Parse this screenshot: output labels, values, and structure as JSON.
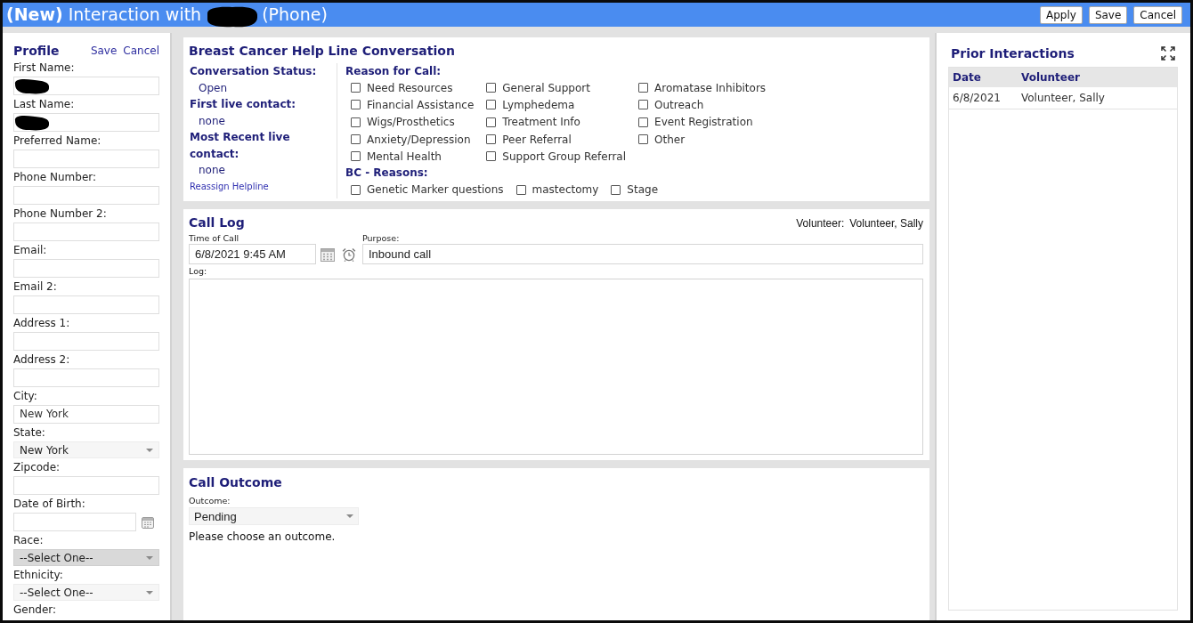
{
  "header": {
    "badge": "(New)",
    "title": "Interaction with",
    "contact_redacted": true,
    "channel": "(Phone)",
    "buttons": [
      "Apply",
      "Save",
      "Cancel"
    ]
  },
  "profile": {
    "title": "Profile",
    "actions": [
      "Save",
      "Cancel"
    ],
    "fields": [
      {
        "label": "First Name:",
        "kind": "text",
        "redacted": true
      },
      {
        "label": "Last Name:",
        "kind": "text",
        "redacted": true
      },
      {
        "label": "Preferred Name:",
        "kind": "text",
        "redacted": false
      },
      {
        "label": "Phone Number:",
        "kind": "text",
        "redacted": false
      },
      {
        "label": "Phone Number 2:",
        "kind": "text",
        "redacted": false
      },
      {
        "label": "Email:",
        "kind": "text",
        "redacted": false
      },
      {
        "label": "Email 2:",
        "kind": "text",
        "redacted": false
      },
      {
        "label": "Address 1:",
        "kind": "text",
        "redacted": false
      },
      {
        "label": "Address 2:",
        "kind": "text",
        "redacted": false
      },
      {
        "label": "City:",
        "kind": "text",
        "value": "New York",
        "redacted": false
      },
      {
        "label": "State:",
        "kind": "select",
        "value": "New York",
        "highlighted": false
      },
      {
        "label": "Zipcode:",
        "kind": "text",
        "redacted": false
      },
      {
        "label": "Date of Birth:",
        "kind": "date",
        "redacted": false
      },
      {
        "label": "Race:",
        "kind": "select",
        "value": "--Select One--",
        "highlighted": true
      },
      {
        "label": "Ethnicity:",
        "kind": "select",
        "value": "--Select One--",
        "highlighted": false
      },
      {
        "label": "Gender:",
        "kind": "label"
      }
    ]
  },
  "conversation": {
    "title": "Breast Cancer Help Line Conversation",
    "status": [
      {
        "label": "Conversation Status:",
        "value": "Open"
      },
      {
        "label": "First live contact:",
        "value": "none"
      },
      {
        "label": "Most Recent live contact:",
        "value": "none"
      }
    ],
    "link": "Reassign Helpline",
    "reason_groups": [
      {
        "title": "Reason for Call:",
        "kind": "grid",
        "options": [
          {
            "label": "Need Resources",
            "checked": false
          },
          {
            "label": "General Support",
            "checked": false
          },
          {
            "label": "Aromatase Inhibitors",
            "checked": false
          },
          {
            "label": "Financial Assistance",
            "checked": false
          },
          {
            "label": "Lymphedema",
            "checked": false
          },
          {
            "label": "Outreach",
            "checked": false
          },
          {
            "label": "Wigs/Prosthetics",
            "checked": false
          },
          {
            "label": "Treatment Info",
            "checked": false
          },
          {
            "label": "Event Registration",
            "checked": false
          },
          {
            "label": "Anxiety/Depression",
            "checked": false
          },
          {
            "label": "Peer Referral",
            "checked": false
          },
          {
            "label": "Other",
            "checked": false
          },
          {
            "label": "Mental Health",
            "checked": false
          },
          {
            "label": "Support Group Referral",
            "checked": false
          }
        ]
      },
      {
        "title": "BC - Reasons:",
        "kind": "row",
        "options": [
          {
            "label": "Genetic Marker questions",
            "checked": false
          },
          {
            "label": "mastectomy",
            "checked": false
          },
          {
            "label": "Stage",
            "checked": false
          }
        ]
      }
    ]
  },
  "call_log": {
    "title": "Call Log",
    "volunteer_label": "Volunteer:",
    "volunteer": "Volunteer, Sally",
    "time_label": "Time of Call",
    "time": "6/8/2021 9:45 AM",
    "purpose_label": "Purpose:",
    "purpose": "Inbound call",
    "log_label": "Log:"
  },
  "call_outcome": {
    "title": "Call Outcome",
    "outcome_label": "Outcome:",
    "outcome": "Pending",
    "message": "Please choose an outcome."
  },
  "prior_interactions": {
    "title": "Prior Interactions",
    "columns": [
      "Date",
      "Volunteer"
    ],
    "rows": [
      [
        "6/8/2021",
        "Volunteer, Sally"
      ]
    ]
  }
}
